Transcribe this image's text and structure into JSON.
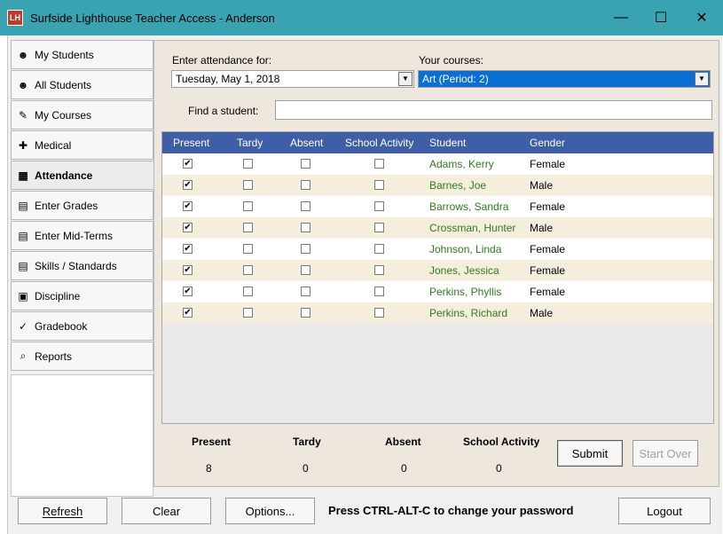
{
  "window": {
    "icon_text": "LH",
    "title": "Surfside Lighthouse Teacher Access - Anderson",
    "minimize": "—",
    "maximize": "☐",
    "close": "✕"
  },
  "sidebar": {
    "items": [
      {
        "label": "My Students",
        "icon": "students-icon",
        "glyph": "☻"
      },
      {
        "label": "All Students",
        "icon": "all-students-icon",
        "glyph": "☻"
      },
      {
        "label": "My Courses",
        "icon": "books-icon",
        "glyph": "✎"
      },
      {
        "label": "Medical",
        "icon": "medical-icon",
        "glyph": "✚"
      },
      {
        "label": "Attendance",
        "icon": "calendar-icon",
        "glyph": "▦"
      },
      {
        "label": "Enter Grades",
        "icon": "grades-icon",
        "glyph": "▤"
      },
      {
        "label": "Enter Mid-Terms",
        "icon": "midterms-icon",
        "glyph": "▤"
      },
      {
        "label": "Skills / Standards",
        "icon": "skills-icon",
        "glyph": "▤"
      },
      {
        "label": "Discipline",
        "icon": "discipline-icon",
        "glyph": "▣"
      },
      {
        "label": "Gradebook",
        "icon": "checkmark-icon",
        "glyph": "✓"
      },
      {
        "label": "Reports",
        "icon": "reports-icon",
        "glyph": "⌕"
      }
    ],
    "active_index": 4
  },
  "attendance": {
    "date_label": "Enter attendance for:",
    "date_value": "Tuesday, May 1, 2018",
    "courses_label": "Your courses:",
    "course_value": "Art (Period: 2)",
    "find_label": "Find a student:",
    "find_value": "",
    "columns": [
      "Present",
      "Tardy",
      "Absent",
      "School Activity",
      "Student",
      "Gender"
    ],
    "rows": [
      {
        "present": true,
        "tardy": false,
        "absent": false,
        "activity": false,
        "student": "Adams, Kerry",
        "gender": "Female"
      },
      {
        "present": true,
        "tardy": false,
        "absent": false,
        "activity": false,
        "student": "Barnes, Joe",
        "gender": "Male"
      },
      {
        "present": true,
        "tardy": false,
        "absent": false,
        "activity": false,
        "student": "Barrows, Sandra",
        "gender": "Female"
      },
      {
        "present": true,
        "tardy": false,
        "absent": false,
        "activity": false,
        "student": "Crossman, Hunter",
        "gender": "Male"
      },
      {
        "present": true,
        "tardy": false,
        "absent": false,
        "activity": false,
        "student": "Johnson, Linda",
        "gender": "Female"
      },
      {
        "present": true,
        "tardy": false,
        "absent": false,
        "activity": false,
        "student": "Jones, Jessica",
        "gender": "Female"
      },
      {
        "present": true,
        "tardy": false,
        "absent": false,
        "activity": false,
        "student": "Perkins, Phyllis",
        "gender": "Female"
      },
      {
        "present": true,
        "tardy": false,
        "absent": false,
        "activity": false,
        "student": "Perkins, Richard",
        "gender": "Male"
      }
    ],
    "summary": {
      "present_label": "Present",
      "present_value": "8",
      "tardy_label": "Tardy",
      "tardy_value": "0",
      "absent_label": "Absent",
      "absent_value": "0",
      "activity_label": "School Activity",
      "activity_value": "0"
    },
    "submit_label": "Submit",
    "start_over_label": "Start Over"
  },
  "footer": {
    "refresh_label": "Refresh",
    "clear_label": "Clear",
    "options_label": "Options...",
    "password_hint": "Press CTRL-ALT-C to change your password",
    "logout_label": "Logout"
  },
  "colors": {
    "titlebar": "#3aa3b2",
    "grid_header": "#3e5ea8",
    "row_alt": "#f5eedd",
    "student_text": "#2f7a1f",
    "selected_course": "#0a6fd1"
  }
}
